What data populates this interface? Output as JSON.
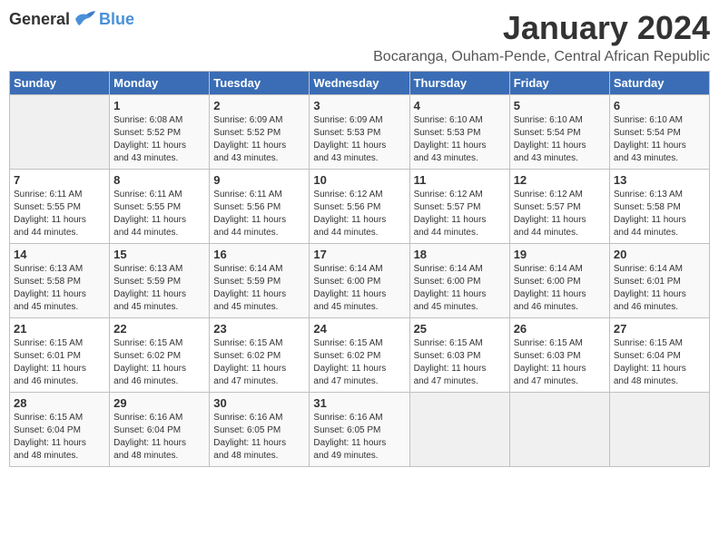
{
  "logo": {
    "general": "General",
    "blue": "Blue"
  },
  "title": "January 2024",
  "subtitle": "Bocaranga, Ouham-Pende, Central African Republic",
  "weekdays": [
    "Sunday",
    "Monday",
    "Tuesday",
    "Wednesday",
    "Thursday",
    "Friday",
    "Saturday"
  ],
  "weeks": [
    [
      {
        "day": "",
        "detail": ""
      },
      {
        "day": "1",
        "detail": "Sunrise: 6:08 AM\nSunset: 5:52 PM\nDaylight: 11 hours\nand 43 minutes."
      },
      {
        "day": "2",
        "detail": "Sunrise: 6:09 AM\nSunset: 5:52 PM\nDaylight: 11 hours\nand 43 minutes."
      },
      {
        "day": "3",
        "detail": "Sunrise: 6:09 AM\nSunset: 5:53 PM\nDaylight: 11 hours\nand 43 minutes."
      },
      {
        "day": "4",
        "detail": "Sunrise: 6:10 AM\nSunset: 5:53 PM\nDaylight: 11 hours\nand 43 minutes."
      },
      {
        "day": "5",
        "detail": "Sunrise: 6:10 AM\nSunset: 5:54 PM\nDaylight: 11 hours\nand 43 minutes."
      },
      {
        "day": "6",
        "detail": "Sunrise: 6:10 AM\nSunset: 5:54 PM\nDaylight: 11 hours\nand 43 minutes."
      }
    ],
    [
      {
        "day": "7",
        "detail": "Sunrise: 6:11 AM\nSunset: 5:55 PM\nDaylight: 11 hours\nand 44 minutes."
      },
      {
        "day": "8",
        "detail": "Sunrise: 6:11 AM\nSunset: 5:55 PM\nDaylight: 11 hours\nand 44 minutes."
      },
      {
        "day": "9",
        "detail": "Sunrise: 6:11 AM\nSunset: 5:56 PM\nDaylight: 11 hours\nand 44 minutes."
      },
      {
        "day": "10",
        "detail": "Sunrise: 6:12 AM\nSunset: 5:56 PM\nDaylight: 11 hours\nand 44 minutes."
      },
      {
        "day": "11",
        "detail": "Sunrise: 6:12 AM\nSunset: 5:57 PM\nDaylight: 11 hours\nand 44 minutes."
      },
      {
        "day": "12",
        "detail": "Sunrise: 6:12 AM\nSunset: 5:57 PM\nDaylight: 11 hours\nand 44 minutes."
      },
      {
        "day": "13",
        "detail": "Sunrise: 6:13 AM\nSunset: 5:58 PM\nDaylight: 11 hours\nand 44 minutes."
      }
    ],
    [
      {
        "day": "14",
        "detail": "Sunrise: 6:13 AM\nSunset: 5:58 PM\nDaylight: 11 hours\nand 45 minutes."
      },
      {
        "day": "15",
        "detail": "Sunrise: 6:13 AM\nSunset: 5:59 PM\nDaylight: 11 hours\nand 45 minutes."
      },
      {
        "day": "16",
        "detail": "Sunrise: 6:14 AM\nSunset: 5:59 PM\nDaylight: 11 hours\nand 45 minutes."
      },
      {
        "day": "17",
        "detail": "Sunrise: 6:14 AM\nSunset: 6:00 PM\nDaylight: 11 hours\nand 45 minutes."
      },
      {
        "day": "18",
        "detail": "Sunrise: 6:14 AM\nSunset: 6:00 PM\nDaylight: 11 hours\nand 45 minutes."
      },
      {
        "day": "19",
        "detail": "Sunrise: 6:14 AM\nSunset: 6:00 PM\nDaylight: 11 hours\nand 46 minutes."
      },
      {
        "day": "20",
        "detail": "Sunrise: 6:14 AM\nSunset: 6:01 PM\nDaylight: 11 hours\nand 46 minutes."
      }
    ],
    [
      {
        "day": "21",
        "detail": "Sunrise: 6:15 AM\nSunset: 6:01 PM\nDaylight: 11 hours\nand 46 minutes."
      },
      {
        "day": "22",
        "detail": "Sunrise: 6:15 AM\nSunset: 6:02 PM\nDaylight: 11 hours\nand 46 minutes."
      },
      {
        "day": "23",
        "detail": "Sunrise: 6:15 AM\nSunset: 6:02 PM\nDaylight: 11 hours\nand 47 minutes."
      },
      {
        "day": "24",
        "detail": "Sunrise: 6:15 AM\nSunset: 6:02 PM\nDaylight: 11 hours\nand 47 minutes."
      },
      {
        "day": "25",
        "detail": "Sunrise: 6:15 AM\nSunset: 6:03 PM\nDaylight: 11 hours\nand 47 minutes."
      },
      {
        "day": "26",
        "detail": "Sunrise: 6:15 AM\nSunset: 6:03 PM\nDaylight: 11 hours\nand 47 minutes."
      },
      {
        "day": "27",
        "detail": "Sunrise: 6:15 AM\nSunset: 6:04 PM\nDaylight: 11 hours\nand 48 minutes."
      }
    ],
    [
      {
        "day": "28",
        "detail": "Sunrise: 6:15 AM\nSunset: 6:04 PM\nDaylight: 11 hours\nand 48 minutes."
      },
      {
        "day": "29",
        "detail": "Sunrise: 6:16 AM\nSunset: 6:04 PM\nDaylight: 11 hours\nand 48 minutes."
      },
      {
        "day": "30",
        "detail": "Sunrise: 6:16 AM\nSunset: 6:05 PM\nDaylight: 11 hours\nand 48 minutes."
      },
      {
        "day": "31",
        "detail": "Sunrise: 6:16 AM\nSunset: 6:05 PM\nDaylight: 11 hours\nand 49 minutes."
      },
      {
        "day": "",
        "detail": ""
      },
      {
        "day": "",
        "detail": ""
      },
      {
        "day": "",
        "detail": ""
      }
    ]
  ]
}
